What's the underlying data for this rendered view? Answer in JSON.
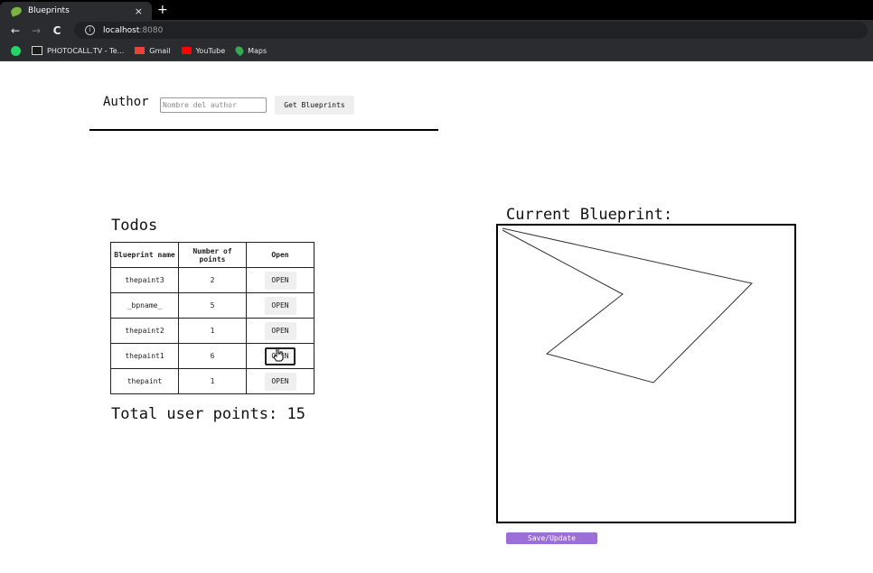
{
  "browser": {
    "tab_title": "Blueprints",
    "tab_close": "×",
    "new_tab": "+",
    "nav": {
      "back": "←",
      "forward": "→",
      "reload": "C",
      "info": "i"
    },
    "url_host": "localhost",
    "url_port": ":8080",
    "bookmarks": [
      {
        "label": "PHOTOCALL.TV - Te...",
        "icon": "tv-icon"
      },
      {
        "label": "Gmail",
        "icon": "gmail-icon"
      },
      {
        "label": "YouTube",
        "icon": "youtube-icon"
      },
      {
        "label": "Maps",
        "icon": "maps-icon"
      }
    ]
  },
  "author": {
    "label": "Author",
    "placeholder": "Nombre del author",
    "value": "",
    "button": "Get Blueprints"
  },
  "list": {
    "title": "Todos",
    "headers": {
      "name": "Blueprint name",
      "points": "Number of points",
      "open": "Open"
    },
    "rows": [
      {
        "name": "thepaint3",
        "points": "2",
        "open": "OPEN"
      },
      {
        "name": "_bpname_",
        "points": "5",
        "open": "OPEN"
      },
      {
        "name": "thepaint2",
        "points": "1",
        "open": "OPEN"
      },
      {
        "name": "thepaint1",
        "points": "6",
        "open": "OPEN"
      },
      {
        "name": "thepaint",
        "points": "1",
        "open": "OPEN"
      }
    ],
    "total": "Total user points: 15"
  },
  "current": {
    "title": "Current Blueprint:",
    "save_button": "Save/Update",
    "drawing_points": [
      [
        5,
        5
      ],
      [
        138,
        76
      ],
      [
        54,
        142
      ],
      [
        172,
        174
      ],
      [
        281,
        64
      ],
      [
        5,
        3
      ]
    ]
  },
  "colors": {
    "accent_button": "#9b6fd6",
    "chrome": "#2b2c2f",
    "tabbar": "#000000"
  }
}
